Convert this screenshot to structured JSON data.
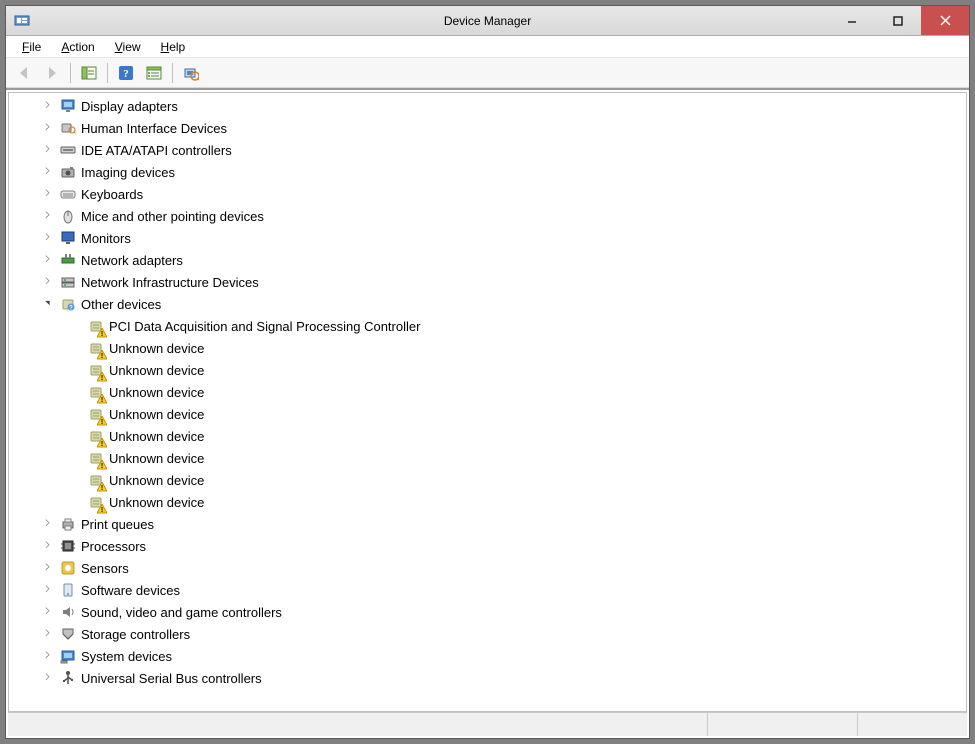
{
  "window": {
    "title": "Device Manager"
  },
  "menu": {
    "file": "File",
    "action": "Action",
    "view": "View",
    "help": "Help"
  },
  "tree": {
    "categories": [
      {
        "id": "display-adapters",
        "label": "Display adapters",
        "icon": "display",
        "expanded": false
      },
      {
        "id": "hid",
        "label": "Human Interface Devices",
        "icon": "hid",
        "expanded": false
      },
      {
        "id": "ide",
        "label": "IDE ATA/ATAPI controllers",
        "icon": "ide",
        "expanded": false
      },
      {
        "id": "imaging",
        "label": "Imaging devices",
        "icon": "camera",
        "expanded": false
      },
      {
        "id": "keyboards",
        "label": "Keyboards",
        "icon": "keyboard",
        "expanded": false
      },
      {
        "id": "mice",
        "label": "Mice and other pointing devices",
        "icon": "mouse",
        "expanded": false
      },
      {
        "id": "monitors",
        "label": "Monitors",
        "icon": "monitor",
        "expanded": false
      },
      {
        "id": "network",
        "label": "Network adapters",
        "icon": "network",
        "expanded": false
      },
      {
        "id": "netinfra",
        "label": "Network Infrastructure Devices",
        "icon": "netinfra",
        "expanded": false
      },
      {
        "id": "other",
        "label": "Other devices",
        "icon": "other",
        "expanded": true,
        "children": [
          {
            "label": "PCI Data Acquisition and Signal Processing Controller",
            "warn": true
          },
          {
            "label": "Unknown device",
            "warn": true
          },
          {
            "label": "Unknown device",
            "warn": true
          },
          {
            "label": "Unknown device",
            "warn": true
          },
          {
            "label": "Unknown device",
            "warn": true
          },
          {
            "label": "Unknown device",
            "warn": true
          },
          {
            "label": "Unknown device",
            "warn": true
          },
          {
            "label": "Unknown device",
            "warn": true
          },
          {
            "label": "Unknown device",
            "warn": true
          }
        ]
      },
      {
        "id": "printq",
        "label": "Print queues",
        "icon": "printer",
        "expanded": false
      },
      {
        "id": "processors",
        "label": "Processors",
        "icon": "cpu",
        "expanded": false
      },
      {
        "id": "sensors",
        "label": "Sensors",
        "icon": "sensor",
        "expanded": false
      },
      {
        "id": "software",
        "label": "Software devices",
        "icon": "software",
        "expanded": false
      },
      {
        "id": "sound",
        "label": "Sound, video and game controllers",
        "icon": "sound",
        "expanded": false
      },
      {
        "id": "storage",
        "label": "Storage controllers",
        "icon": "storage",
        "expanded": false
      },
      {
        "id": "system",
        "label": "System devices",
        "icon": "system",
        "expanded": false
      },
      {
        "id": "usb",
        "label": "Universal Serial Bus controllers",
        "icon": "usb",
        "expanded": false
      }
    ]
  }
}
